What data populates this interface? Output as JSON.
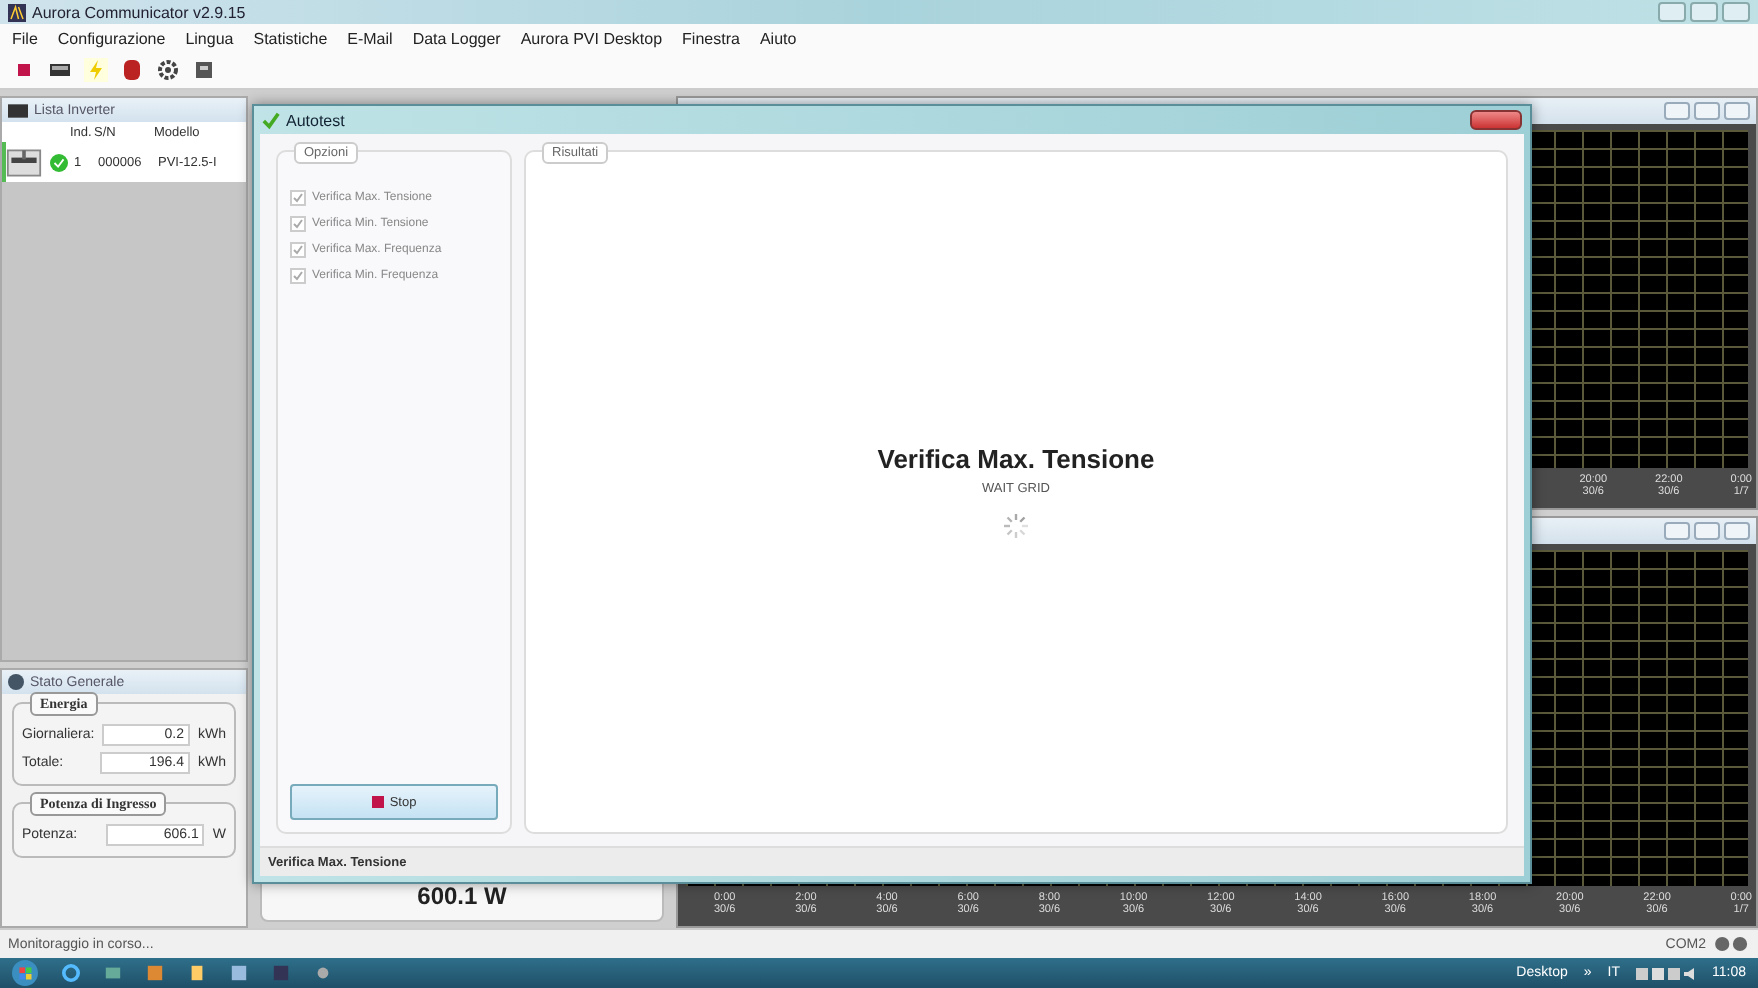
{
  "window": {
    "title": "Aurora Communicator v2.9.15"
  },
  "menu": [
    "File",
    "Configurazione",
    "Lingua",
    "Statistiche",
    "E-Mail",
    "Data Logger",
    "Aurora PVI Desktop",
    "Finestra",
    "Aiuto"
  ],
  "inverter_list": {
    "title": "Lista Inverter",
    "columns": [
      "Ind.",
      "S/N",
      "Modello"
    ],
    "rows": [
      {
        "ind": "1",
        "sn": "000006",
        "model": "PVI-12.5-I"
      }
    ]
  },
  "status": {
    "title": "Stato Generale",
    "groups": [
      {
        "legend": "Energia",
        "fields": [
          {
            "label": "Giornaliera:",
            "value": "0.2",
            "unit": "kWh"
          },
          {
            "label": "Totale:",
            "value": "196.4",
            "unit": "kWh"
          }
        ]
      },
      {
        "legend": "Potenza di Ingresso",
        "fields": [
          {
            "label": "Potenza:",
            "value": "606.1",
            "unit": "W"
          }
        ]
      }
    ]
  },
  "power_display": "600.1 W",
  "charts": [
    {
      "axis": [
        {
          "time": "20:00",
          "date": "30/6"
        },
        {
          "time": "22:00",
          "date": "30/6"
        },
        {
          "time": "0:00",
          "date": "1/7"
        }
      ]
    },
    {
      "axis": [
        {
          "time": "0:00",
          "date": "30/6"
        },
        {
          "time": "2:00",
          "date": "30/6"
        },
        {
          "time": "4:00",
          "date": "30/6"
        },
        {
          "time": "6:00",
          "date": "30/6"
        },
        {
          "time": "8:00",
          "date": "30/6"
        },
        {
          "time": "10:00",
          "date": "30/6"
        },
        {
          "time": "12:00",
          "date": "30/6"
        },
        {
          "time": "14:00",
          "date": "30/6"
        },
        {
          "time": "16:00",
          "date": "30/6"
        },
        {
          "time": "18:00",
          "date": "30/6"
        },
        {
          "time": "20:00",
          "date": "30/6"
        },
        {
          "time": "22:00",
          "date": "30/6"
        },
        {
          "time": "0:00",
          "date": "1/7"
        }
      ]
    }
  ],
  "dialog": {
    "title": "Autotest",
    "options": {
      "legend": "Opzioni",
      "items": [
        {
          "label": "Verifica Max. Tensione",
          "checked": true,
          "disabled": true
        },
        {
          "label": "Verifica Min. Tensione",
          "checked": true,
          "disabled": true
        },
        {
          "label": "Verifica Max. Frequenza",
          "checked": true,
          "disabled": true
        },
        {
          "label": "Verifica Min. Frequenza",
          "checked": true,
          "disabled": true
        }
      ]
    },
    "stop_button": "Stop",
    "results": {
      "legend": "Risultati",
      "heading": "Verifica Max. Tensione",
      "subheading": "WAIT GRID"
    },
    "status": "Verifica Max. Tensione"
  },
  "status_bar": {
    "message": "Monitoraggio in corso...",
    "port": "COM2"
  },
  "taskbar": {
    "desktop": "Desktop",
    "more": "»",
    "language": "IT",
    "clock": "11:08"
  }
}
